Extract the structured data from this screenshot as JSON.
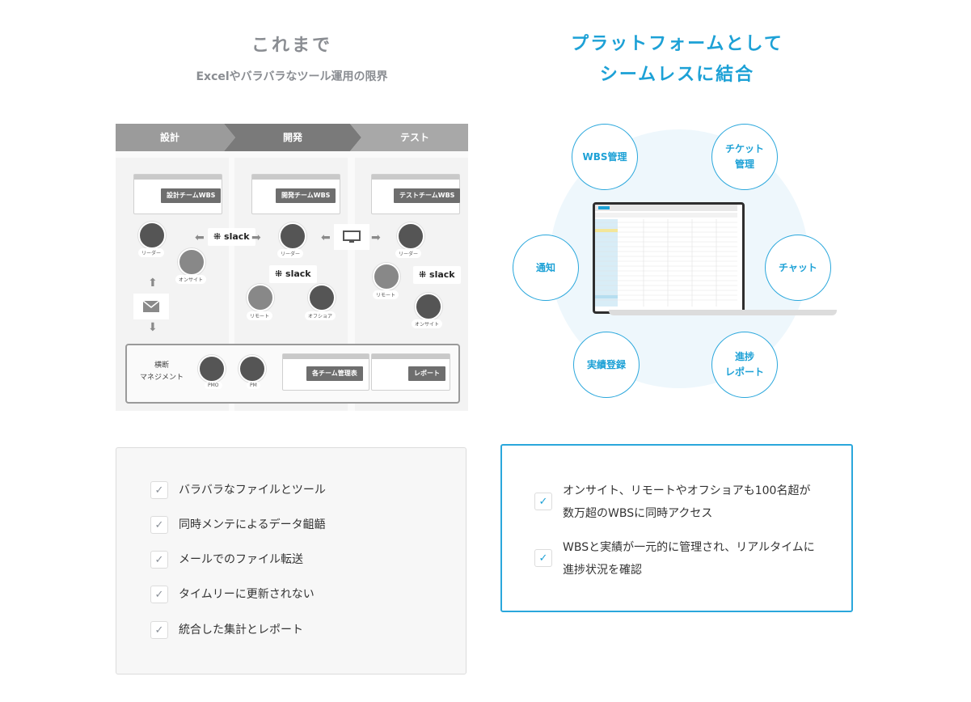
{
  "left": {
    "title": "これまで",
    "subtitle": "Excelやバラバラなツール運用の限界",
    "phases": [
      "設計",
      "開発",
      "テスト"
    ],
    "wbs_tags": [
      "設計チームWBS",
      "開発チームWBS",
      "テストチームWBS"
    ],
    "slack_label": "slack",
    "people": {
      "leader": "リーダー",
      "onsite": "オンサイト",
      "remote": "リモート",
      "offshore": "オフショア",
      "pmo": "PMO",
      "pm": "PM"
    },
    "management_label": "横断\nマネジメント",
    "mgmt_tags": [
      "各チーム管理表",
      "レポート"
    ],
    "checklist": [
      "バラバラなファイルとツール",
      "同時メンテによるデータ齟齬",
      "メールでのファイル転送",
      "タイムリーに更新されない",
      "統合した集計とレポート"
    ]
  },
  "right": {
    "title_line1": "プラットフォームとして",
    "title_line2": "シームレスに結合",
    "bubbles": {
      "wbs": "WBS管理",
      "ticket": "チケット\n管理",
      "notify": "通知",
      "chat": "チャット",
      "actual": "実績登録",
      "progress": "進捗\nレポート"
    },
    "checklist": [
      "オンサイト、リモートやオフショアも100名超が数万超のWBSに同時アクセス",
      "WBSと実績が一元的に管理され、リアルタイムに進捗状況を確認"
    ]
  },
  "colors": {
    "accent": "#1da1d6",
    "muted_title": "#8a8d92"
  },
  "icons": {
    "check": "checkmark-icon",
    "arrow": "arrow-icon",
    "slack": "slack-logo-icon",
    "monitor": "monitor-icon",
    "mail": "mail-icon"
  }
}
